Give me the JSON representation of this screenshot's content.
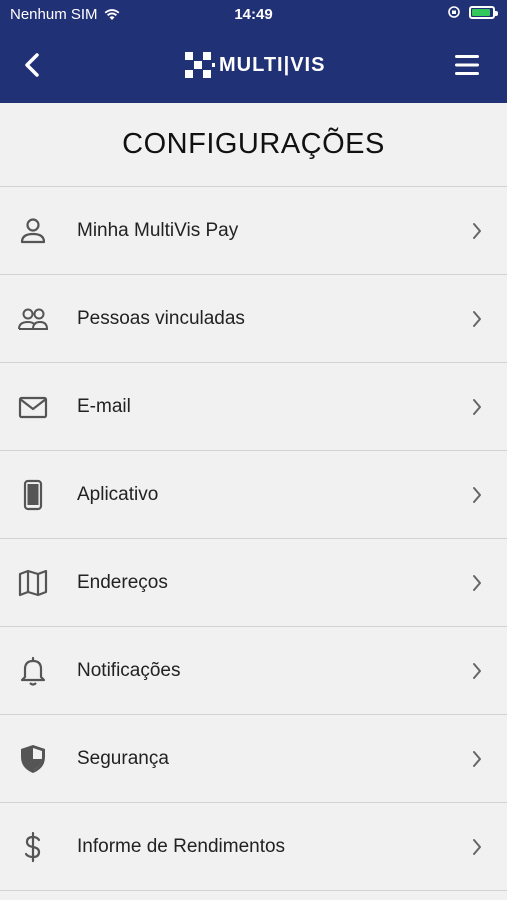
{
  "status_bar": {
    "carrier": "Nenhum SIM",
    "time": "14:49"
  },
  "header": {
    "logo_text": "MULTI|VIS"
  },
  "page": {
    "title": "CONFIGURAÇÕES"
  },
  "menu_items": [
    {
      "label": "Minha MultiVis Pay",
      "icon": "person-icon"
    },
    {
      "label": "Pessoas vinculadas",
      "icon": "people-icon"
    },
    {
      "label": "E-mail",
      "icon": "envelope-icon"
    },
    {
      "label": "Aplicativo",
      "icon": "phone-icon"
    },
    {
      "label": "Endereços",
      "icon": "map-icon"
    },
    {
      "label": "Notificações",
      "icon": "bell-icon"
    },
    {
      "label": "Segurança",
      "icon": "shield-icon"
    },
    {
      "label": "Informe de Rendimentos",
      "icon": "dollar-icon"
    }
  ],
  "colors": {
    "header": "#213176",
    "background": "#f1f1f1",
    "icon": "#555555"
  }
}
